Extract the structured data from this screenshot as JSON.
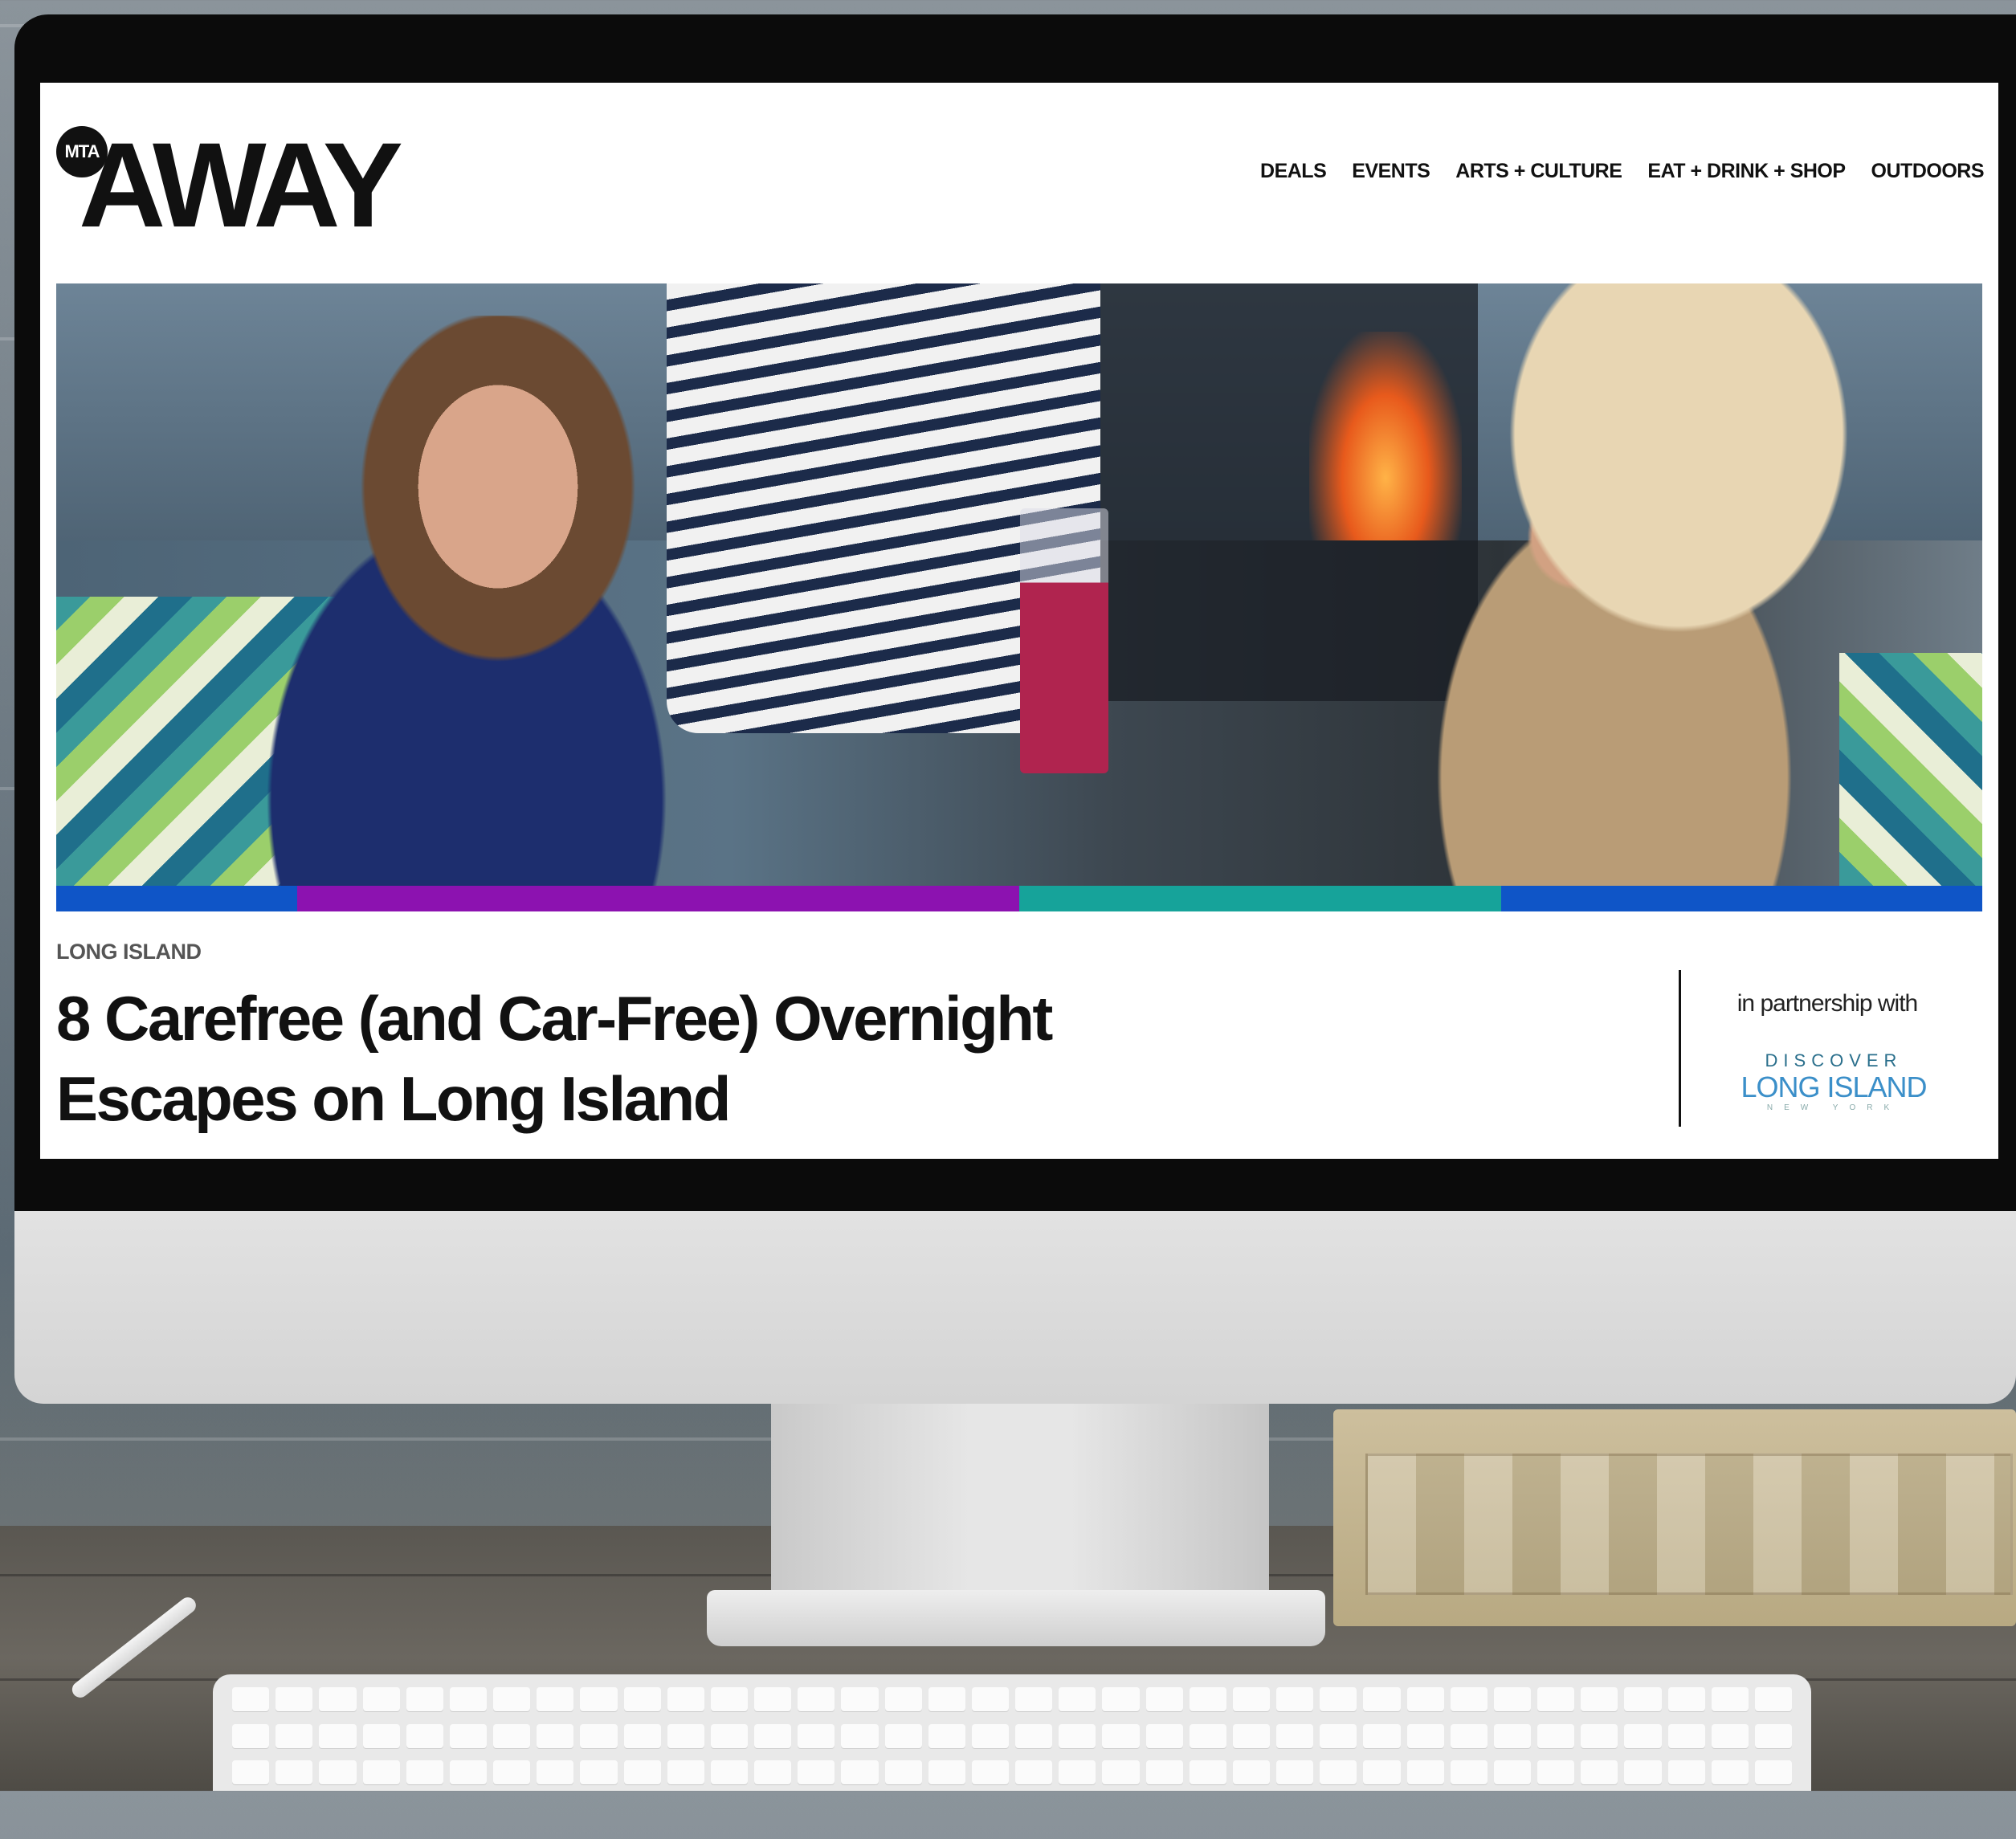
{
  "site": {
    "logo_badge": "MTA",
    "logo_word": "AWAY"
  },
  "nav": {
    "items": [
      {
        "label": "DEALS"
      },
      {
        "label": "EVENTS"
      },
      {
        "label": "ARTS + CULTURE"
      },
      {
        "label": "EAT + DRINK + SHOP"
      },
      {
        "label": "OUTDOORS"
      }
    ]
  },
  "hero": {
    "color_bar": [
      {
        "color": "#0f55c7",
        "fraction": 0.125
      },
      {
        "color": "#8c12b0",
        "fraction": 0.375
      },
      {
        "color": "#16a39a",
        "fraction": 0.25
      },
      {
        "color": "#0f55c7",
        "fraction": 0.25
      }
    ]
  },
  "article": {
    "category": "LONG ISLAND",
    "headline_line1": "8 Carefree (and Car-Free) Overnight",
    "headline_line2": "Escapes on Long Island"
  },
  "partner": {
    "label": "in partnership with",
    "logo_top": "DISCOVER",
    "logo_main": "LONG ISLAND",
    "logo_sub": "NEW YORK"
  }
}
